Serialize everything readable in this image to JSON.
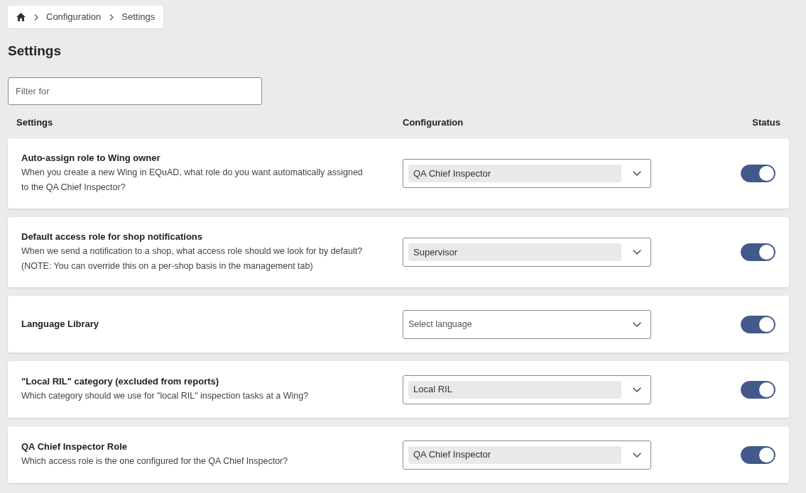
{
  "breadcrumb": {
    "items": [
      "Configuration",
      "Settings"
    ]
  },
  "page_title": "Settings",
  "filter": {
    "placeholder": "Filter for"
  },
  "columns": [
    "Settings",
    "Configuration",
    "Status"
  ],
  "settings": [
    {
      "title": "Auto-assign role to Wing owner",
      "description": [
        "When you create a new Wing in EQuAD, what role do you want automatically assigned",
        "to the QA Chief Inspector?"
      ],
      "select": {
        "value": "QA Chief Inspector"
      },
      "on": true
    },
    {
      "title": "Default access role for shop notifications",
      "description": [
        "When we send a notification to a shop, what access role should we look for by default?",
        "(NOTE: You can override this on a per-shop basis in the management tab)"
      ],
      "select": {
        "value": "Supervisor"
      },
      "on": true
    },
    {
      "title": "Language Library",
      "select": {
        "placeholder": "Select language"
      },
      "on": true
    },
    {
      "title": "\"Local RIL\" category (excluded from reports)",
      "description": [
        "Which category should we use for \"local RIL\" inspection tasks at a Wing?"
      ],
      "select": {
        "value": "Local RIL"
      },
      "on": true
    },
    {
      "title": "QA Chief Inspector Role",
      "description": [
        "Which access role is the one configured for the QA Chief Inspector?"
      ],
      "select": {
        "value": "QA Chief Inspector"
      },
      "on": true
    }
  ]
}
